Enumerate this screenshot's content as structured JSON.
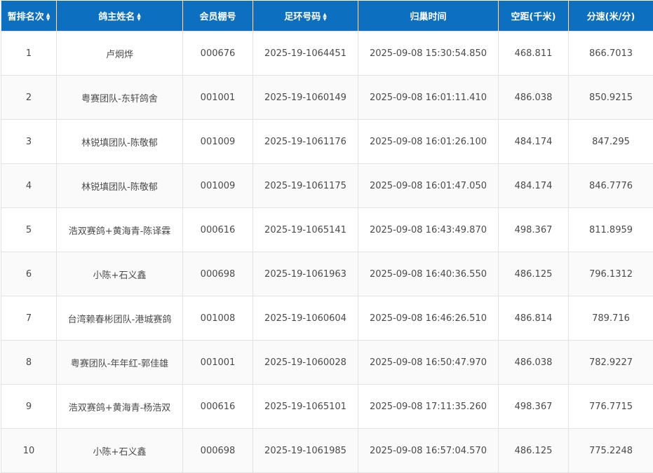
{
  "table": {
    "headers": [
      "暂排名次",
      "鸽主姓名",
      "会员棚号",
      "足环号码",
      "归巢时间",
      "空距(千米)",
      "分速(米/分)"
    ],
    "sortable": [
      true,
      true,
      false,
      true,
      false,
      false,
      false
    ],
    "rows": [
      [
        "1",
        "卢炯烨",
        "000676",
        "2025-19-1064451",
        "2025-09-08 15:30:54.850",
        "468.811",
        "866.7013"
      ],
      [
        "2",
        "粤赛团队-东轩鸽舍",
        "001001",
        "2025-19-1060149",
        "2025-09-08 16:01:11.410",
        "486.038",
        "850.9215"
      ],
      [
        "3",
        "林锐填团队-陈敬郁",
        "001009",
        "2025-19-1061176",
        "2025-09-08 16:01:26.100",
        "484.174",
        "847.295"
      ],
      [
        "4",
        "林锐填团队-陈敬郁",
        "001009",
        "2025-19-1061175",
        "2025-09-08 16:01:47.050",
        "484.174",
        "846.7776"
      ],
      [
        "5",
        "浩双赛鸽+黄海青-陈译霖",
        "000616",
        "2025-19-1065141",
        "2025-09-08 16:43:49.870",
        "498.367",
        "811.8959"
      ],
      [
        "6",
        "小陈+石义鑫",
        "000698",
        "2025-19-1061963",
        "2025-09-08 16:40:36.550",
        "486.125",
        "796.1312"
      ],
      [
        "7",
        "台湾赖春彬团队-港城赛鸽",
        "001008",
        "2025-19-1060604",
        "2025-09-08 16:46:26.510",
        "486.814",
        "789.716"
      ],
      [
        "8",
        "粤赛团队-年年红-郭佳雄",
        "001001",
        "2025-19-1060028",
        "2025-09-08 16:50:47.970",
        "486.038",
        "782.9227"
      ],
      [
        "9",
        "浩双赛鸽+黄海青-杨浩双",
        "000616",
        "2025-19-1065101",
        "2025-09-08 17:11:35.260",
        "498.367",
        "776.7715"
      ],
      [
        "10",
        "小陈+石义鑫",
        "000698",
        "2025-19-1061985",
        "2025-09-08 16:57:04.570",
        "486.125",
        "775.2248"
      ]
    ]
  },
  "colors": {
    "header_bg": "#0d6fc0",
    "header_text": "#ffffff",
    "cell_text": "#4a4a4a",
    "border": "#e3e3e3",
    "row_alt": "#fafafa"
  },
  "icons": {
    "sort": "sort-updown-icon"
  }
}
